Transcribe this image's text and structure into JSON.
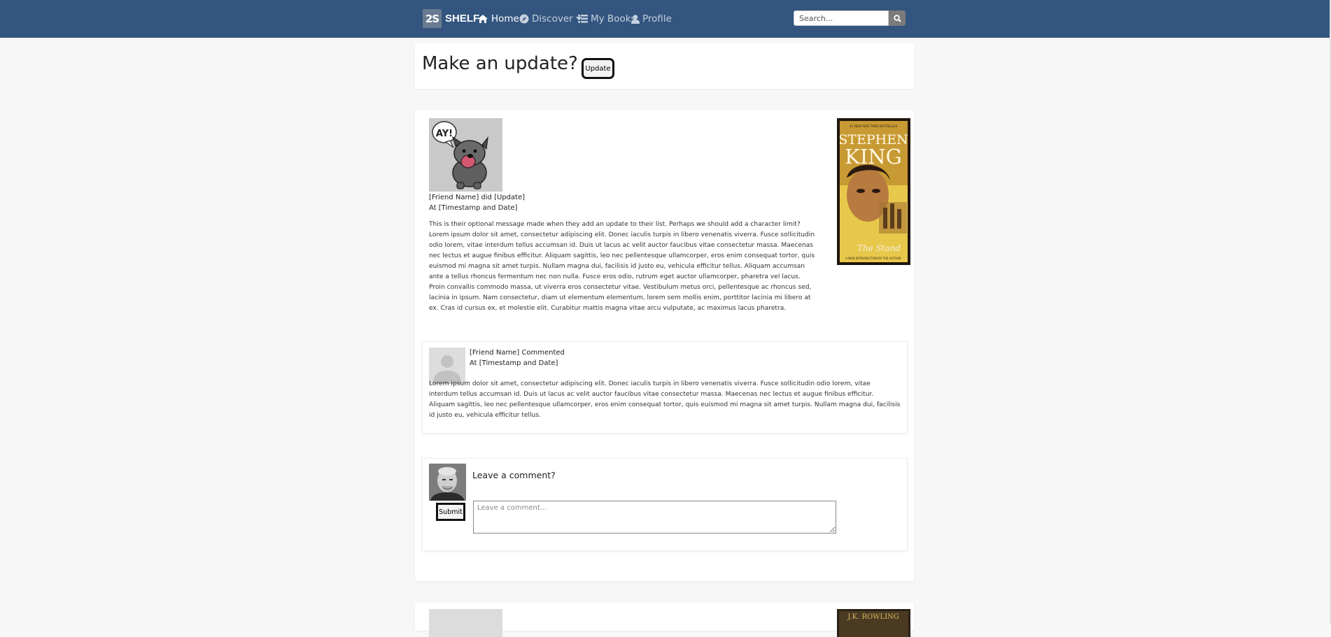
{
  "nav": {
    "logo_mark": "2S",
    "logo_text": "SHELF",
    "items": [
      {
        "label": "Home",
        "icon": "home-icon"
      },
      {
        "label": "Discover",
        "icon": "compass-icon"
      },
      {
        "label": "My Books",
        "icon": "list-icon"
      },
      {
        "label": "Profile",
        "icon": "user-icon"
      }
    ],
    "search_placeholder": "Search..."
  },
  "update_prompt": {
    "title": "Make an update?",
    "button_label": "Update"
  },
  "post": {
    "headline": "[Friend Name] did [Update]",
    "timestamp": "At [Timestamp and Date]",
    "message": "This is their optional message made when they add an update to their list. Perhaps we should add a character limit? Lorem ipsum dolor sit amet, consectetur adipiscing elit. Donec iaculis turpis in libero venenatis viverra. Fusce sollicitudin odio lorem, vitae interdum tellus accumsan id. Duis ut lacus ac velit auctor faucibus vitae consectetur massa. Maecenas nec lectus et augue finibus efficitur. Aliquam sagittis, leo nec pellentesque ullamcorper, eros enim consequat tortor, quis euismod mi magna sit amet turpis. Nullam magna dui, facilisis id justo eu, vehicula efficitur tellus. Aliquam accumsan ante a tellus rhoncus fermentum nec non nulla. Fusce eros odio, rutrum eget auctor ullamcorper, pharetra vel lacus. Proin convallis commodo massa, ut viverra eros consectetur vitae. Vestibulum metus orci, pellentesque ac rhoncus sed, lacinia in ipsum. Nam consectetur, diam ut elementum elementum, lorem sem mollis enim, porttitor lacinia mi libero at ex. Cras id cursus ex, et molestie elit. Curabitur mattis magna vitae arcu vulputate, ac maximus lacus pharetra.",
    "speech_bubble": "AY!",
    "book": {
      "line_top": "#1 NEW YORK TIMES BESTSELLER",
      "author_first": "STEPHEN",
      "author_last": "KING",
      "title": "The Stand",
      "line_bottom": "A NEW INTRODUCTION BY THE AUTHOR"
    }
  },
  "comment": {
    "headline": "[Friend Name] Commented",
    "timestamp": "At [Timestamp and Date]",
    "body": "Lorem ipsum dolor sit amet, consectetur adipiscing elit. Donec iaculis turpis in libero venenatis viverra. Fusce sollicitudin odio lorem, vitae interdum tellus accumsan id. Duis ut lacus ac velit auctor faucibus vitae consectetur massa. Maecenas nec lectus et augue finibus efficitur. Aliquam sagittis, leo nec pellentesque ullamcorper, eros enim consequat tortor, quis euismod mi magna sit amet turpis. Nullam magna dui, facilisis id justo eu, vehicula efficitur tellus."
  },
  "leave_comment": {
    "title": "Leave a comment?",
    "submit_label": "Submit",
    "placeholder": "Leave a comment..."
  },
  "next_post": {
    "book_author": "J.K. ROWLING"
  },
  "colors": {
    "navbar": "#33557f",
    "page_background": "#f7f7f7"
  }
}
